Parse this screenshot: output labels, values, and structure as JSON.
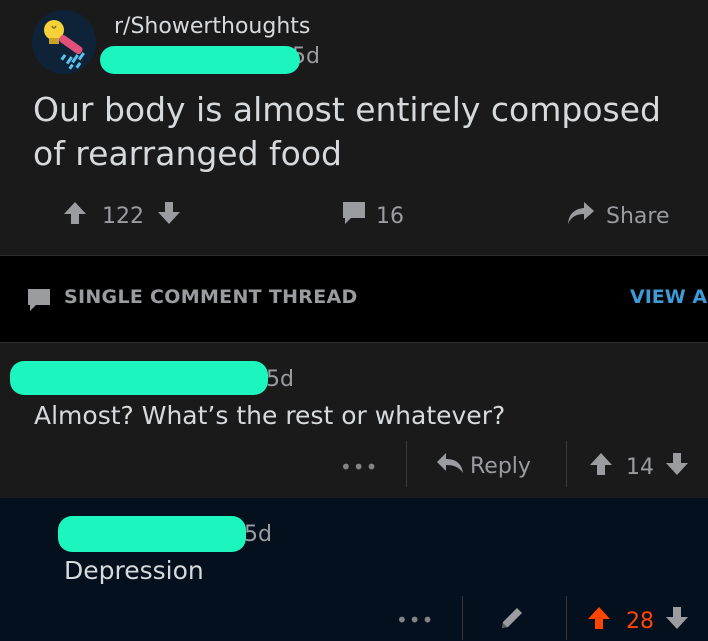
{
  "post": {
    "subreddit": "r/Showerthoughts",
    "age": "5d",
    "title": "Our body is almost entirely composed of rearranged food",
    "upvotes": "122",
    "comments": "16",
    "share_label": "Share"
  },
  "thread": {
    "label": "SINGLE COMMENT THREAD",
    "view_all": "VIEW AL"
  },
  "comment1": {
    "age": "5d",
    "body": "Almost? What’s the rest or whatever?",
    "more": "•••",
    "reply_label": "Reply",
    "score": "14"
  },
  "comment2": {
    "age": "5d",
    "body": "Depression",
    "more": "•••",
    "score": "28"
  },
  "colors": {
    "redaction": "#1cf5be",
    "upvote_active": "#ff4500",
    "link": "#3d9bd8"
  }
}
